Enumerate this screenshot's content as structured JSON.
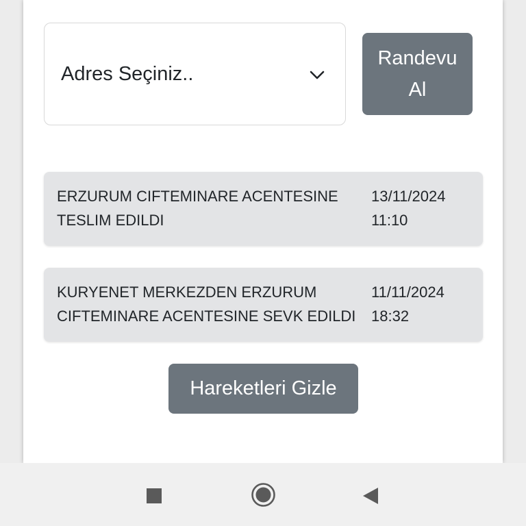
{
  "address_select": {
    "value": "Adres Seçiniz..",
    "icon": "chevron-down-icon"
  },
  "appointment_button": {
    "label_line1": "Randevu",
    "label_line2": "Al"
  },
  "movements": [
    {
      "description_line1": "ERZURUM CIFTEMINARE ACENTESINE",
      "description_line2": "TESLIM EDILDI",
      "date": "13/11/2024",
      "time": "11:10"
    },
    {
      "description_line1": "KURYENET MERKEZDEN ERZURUM",
      "description_line2": "CIFTEMINARE ACENTESINE SEVK EDILDI",
      "date": "11/11/2024",
      "time": "18:32"
    }
  ],
  "hide_movements_button": {
    "label": "Hareketleri Gizle"
  },
  "nav_bar": {
    "recent_icon": "square-icon",
    "home_icon": "circle-home-icon",
    "back_icon": "triangle-back-icon"
  },
  "colors": {
    "button_bg": "#6c757d",
    "movement_bg": "#e3e4e6",
    "text": "#212529"
  }
}
